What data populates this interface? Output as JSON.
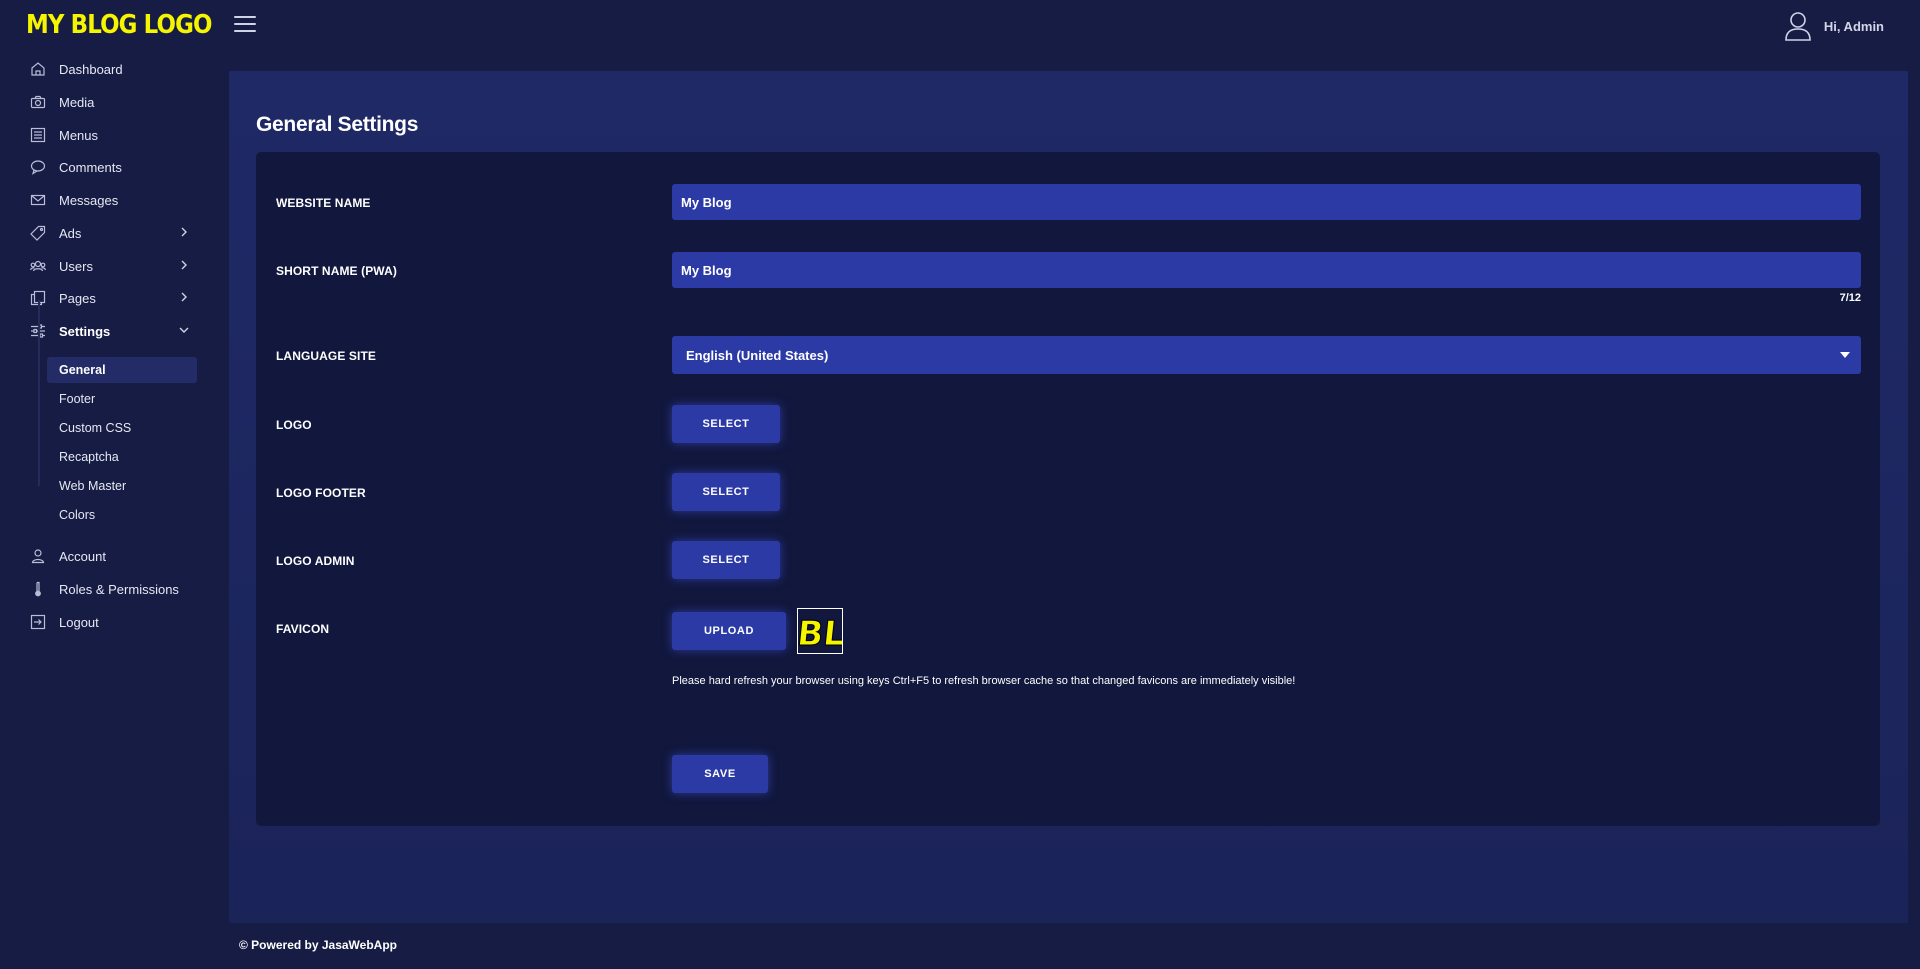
{
  "brand": {
    "logo_text": "MY BLOG LOGO",
    "logo_color": "#f5f500"
  },
  "header": {
    "greeting": "Hi, Admin"
  },
  "sidebar": {
    "items": [
      {
        "label": "Dashboard",
        "icon": "home-icon"
      },
      {
        "label": "Media",
        "icon": "camera-icon"
      },
      {
        "label": "Menus",
        "icon": "list-icon"
      },
      {
        "label": "Comments",
        "icon": "comment-icon"
      },
      {
        "label": "Messages",
        "icon": "mail-icon"
      },
      {
        "label": "Ads",
        "icon": "tag-icon"
      },
      {
        "label": "Users",
        "icon": "users-icon"
      },
      {
        "label": "Pages",
        "icon": "pages-icon"
      },
      {
        "label": "Settings",
        "icon": "sliders-icon"
      },
      {
        "label": "Account",
        "icon": "user-icon"
      },
      {
        "label": "Roles & Permissions",
        "icon": "thermometer-icon"
      },
      {
        "label": "Logout",
        "icon": "logout-icon"
      }
    ],
    "settings_sub": [
      "General",
      "Footer",
      "Custom CSS",
      "Recaptcha",
      "Web Master",
      "Colors"
    ]
  },
  "main": {
    "title": "General Settings",
    "fields": {
      "website_name_label": "WEBSITE NAME",
      "website_name_value": "My Blog",
      "short_name_label": "SHORT NAME (PWA)",
      "short_name_value": "My Blog",
      "short_name_counter": "7/12",
      "language_label": "LANGUAGE SITE",
      "language_value": "English (United States)",
      "logo_label": "LOGO",
      "logo_footer_label": "LOGO FOOTER",
      "logo_admin_label": "LOGO ADMIN",
      "favicon_label": "FAVICON",
      "favicon_preview_text": "BL"
    },
    "buttons": {
      "select": "SELECT",
      "upload": "UPLOAD",
      "save": "SAVE"
    },
    "hint": "Please hard refresh your browser using keys Ctrl+F5 to refresh browser cache so that changed favicons are immediately visible!"
  },
  "footer": {
    "text": "© Powered by JasaWebApp"
  },
  "colors": {
    "background": "#161c44",
    "panel": "#1f2966",
    "card": "#11173d",
    "accent": "#2c3aa6",
    "logo_yellow": "#f5f500"
  }
}
